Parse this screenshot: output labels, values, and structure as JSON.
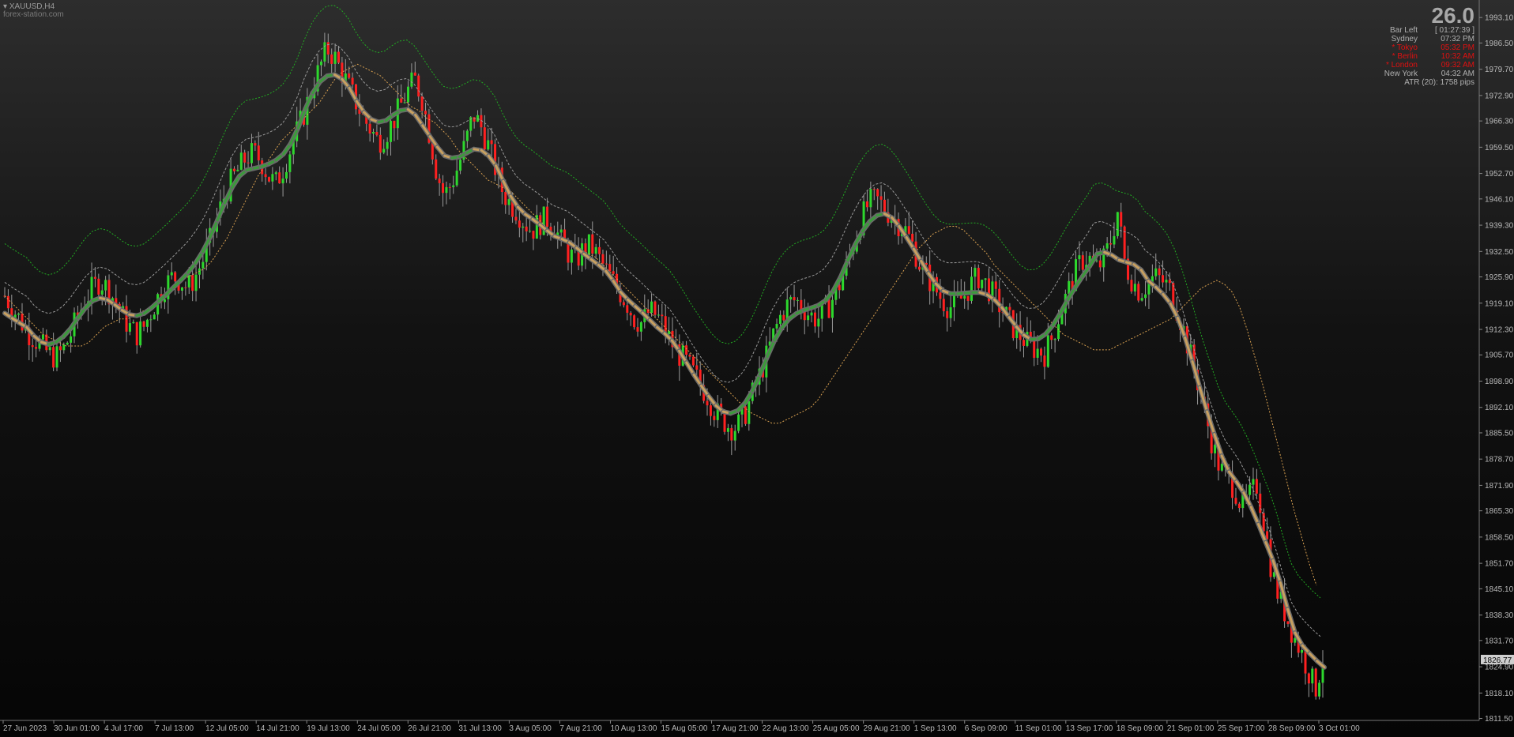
{
  "header": {
    "symbol": "XAUUSD,H4",
    "watermark": "forex-station.com",
    "big_value": "26.0"
  },
  "sessions": [
    {
      "name": "Bar Left",
      "time": "[ 01:27:39 ]",
      "color": "#b0b0b0"
    },
    {
      "name": "Sydney",
      "time": "07:32 PM",
      "color": "#b0b0b0"
    },
    {
      "name": "* Tokyo",
      "time": "05:32 PM",
      "color": "#e01010"
    },
    {
      "name": "* Berlin",
      "time": "10:32 AM",
      "color": "#e01010"
    },
    {
      "name": "* London",
      "time": "09:32 AM",
      "color": "#e01010"
    },
    {
      "name": "New York",
      "time": "04:32 AM",
      "color": "#b0b0b0"
    }
  ],
  "atr_text": "ATR (20): 1758 pips",
  "chart_data": {
    "type": "candlestick",
    "ylim": [
      1811.0,
      1996.0
    ],
    "y_ticks": [
      1993.1,
      1986.5,
      1979.7,
      1972.9,
      1966.3,
      1959.5,
      1952.7,
      1946.1,
      1939.3,
      1932.5,
      1925.9,
      1919.1,
      1912.3,
      1905.7,
      1898.9,
      1892.1,
      1885.5,
      1878.7,
      1871.9,
      1865.3,
      1858.5,
      1851.7,
      1845.1,
      1838.3,
      1831.7,
      1824.9,
      1818.1,
      1811.5
    ],
    "y_tick_labels": [
      "1993.10",
      "1986.50",
      "1979.70",
      "1972.90",
      "1966.30",
      "1959.50",
      "1952.70",
      "1946.10",
      "1939.30",
      "1932.50",
      "1925.90",
      "1919.10",
      "1912.30",
      "1905.70",
      "1898.90",
      "1892.10",
      "1885.50",
      "1878.70",
      "1871.90",
      "1865.30",
      "1858.50",
      "1851.70",
      "1845.10",
      "1838.30",
      "1831.70",
      "1824.90",
      "1818.10",
      "1811.50"
    ],
    "current_price": "1826.77",
    "x_labels": [
      "27 Jun 2023",
      "30 Jun 01:00",
      "4 Jul 17:00",
      "7 Jul 13:00",
      "12 Jul 05:00",
      "14 Jul 21:00",
      "19 Jul 13:00",
      "24 Jul 05:00",
      "26 Jul 21:00",
      "31 Jul 13:00",
      "3 Aug 05:00",
      "7 Aug 21:00",
      "10 Aug 13:00",
      "15 Aug 05:00",
      "17 Aug 21:00",
      "22 Aug 13:00",
      "25 Aug 05:00",
      "29 Aug 21:00",
      "1 Sep 13:00",
      "6 Sep 09:00",
      "11 Sep 01:00",
      "13 Sep 17:00",
      "18 Sep 09:00",
      "21 Sep 01:00",
      "25 Sep 17:00",
      "28 Sep 09:00",
      "3 Oct 01:00"
    ],
    "path_close": [
      1921,
      1918,
      1915,
      1912,
      1910,
      1908,
      1906,
      1905,
      1907,
      1911,
      1916,
      1920,
      1923,
      1925,
      1923,
      1920,
      1916,
      1913,
      1911,
      1913,
      1917,
      1921,
      1924,
      1926,
      1925,
      1923,
      1926,
      1930,
      1935,
      1941,
      1947,
      1951,
      1954,
      1957,
      1958,
      1956,
      1952,
      1950,
      1954,
      1959,
      1964,
      1969,
      1975,
      1980,
      1985,
      1983,
      1979,
      1975,
      1971,
      1967,
      1964,
      1961,
      1963,
      1966,
      1970,
      1974,
      1977,
      1972,
      1963,
      1953,
      1947,
      1950,
      1955,
      1961,
      1968,
      1965,
      1960,
      1954,
      1948,
      1945,
      1943,
      1940,
      1938,
      1940,
      1941,
      1939,
      1935,
      1932,
      1930,
      1933,
      1934,
      1931,
      1928,
      1925,
      1922,
      1919,
      1915,
      1914,
      1917,
      1916,
      1913,
      1909,
      1906,
      1904,
      1901,
      1898,
      1895,
      1891,
      1889,
      1887,
      1887,
      1890,
      1895,
      1900,
      1905,
      1911,
      1916,
      1919,
      1920,
      1918,
      1916,
      1915,
      1917,
      1920,
      1924,
      1929,
      1935,
      1941,
      1945,
      1946,
      1944,
      1942,
      1940,
      1938,
      1934,
      1929,
      1926,
      1923,
      1920,
      1918,
      1919,
      1921,
      1924,
      1926,
      1924,
      1921,
      1918,
      1915,
      1912,
      1910,
      1908,
      1907,
      1906,
      1910,
      1916,
      1921,
      1926,
      1930,
      1931,
      1928,
      1930,
      1935,
      1943,
      1929,
      1925,
      1922,
      1924,
      1926,
      1925,
      1923,
      1918,
      1912,
      1905,
      1898,
      1890,
      1882,
      1876,
      1874,
      1871,
      1866,
      1869,
      1872,
      1862,
      1850,
      1843,
      1838,
      1833,
      1829,
      1824,
      1819,
      1827
    ],
    "ema_slow_orange": [
      1921,
      1919,
      1917,
      1915,
      1913,
      1911,
      1910,
      1909,
      1908,
      1908,
      1908,
      1909,
      1911,
      1913,
      1914,
      1915,
      1915,
      1916,
      1917,
      1918,
      1919,
      1921,
      1923,
      1925,
      1926,
      1927,
      1928,
      1930,
      1933,
      1936,
      1940,
      1944,
      1948,
      1952,
      1955,
      1958,
      1961,
      1963,
      1965,
      1967,
      1969,
      1971,
      1974,
      1977,
      1979,
      1980,
      1981,
      1980,
      1979,
      1978,
      1976,
      1974,
      1972,
      1970,
      1969,
      1967,
      1966,
      1964,
      1962,
      1959,
      1957,
      1955,
      1953,
      1951,
      1950,
      1949,
      1948,
      1946,
      1944,
      1942,
      1940,
      1938,
      1936,
      1935,
      1934,
      1933,
      1932,
      1931,
      1929,
      1927,
      1925,
      1923,
      1921,
      1919,
      1917,
      1915,
      1913,
      1911,
      1909,
      1907,
      1905,
      1903,
      1901,
      1899,
      1897,
      1895,
      1893,
      1891,
      1890,
      1889,
      1888,
      1888,
      1889,
      1890,
      1891,
      1892,
      1894,
      1897,
      1900,
      1903,
      1906,
      1909,
      1912,
      1915,
      1918,
      1921,
      1924,
      1927,
      1930,
      1933,
      1935,
      1937,
      1938,
      1939,
      1939,
      1938,
      1936,
      1934,
      1932,
      1929,
      1927,
      1925,
      1923,
      1921,
      1919,
      1917,
      1915,
      1913,
      1911,
      1910,
      1909,
      1908,
      1907,
      1907,
      1907,
      1908,
      1909,
      1910,
      1911,
      1912,
      1913,
      1914,
      1915,
      1917,
      1919,
      1921,
      1923,
      1924,
      1925,
      1924,
      1922,
      1918,
      1912,
      1905,
      1898,
      1890,
      1882,
      1874,
      1866,
      1859,
      1852,
      1846
    ],
    "series": [
      {
        "name": "smooth trend line",
        "color_up": "#3c9a3c",
        "color_down": "#c8a060"
      },
      {
        "name": "signal line",
        "color": "#2ab82a"
      }
    ],
    "colors": {
      "bull": "#2dd82d",
      "bear": "#ff2020",
      "grid": "#222222",
      "axis": "#9a9a9a"
    }
  }
}
